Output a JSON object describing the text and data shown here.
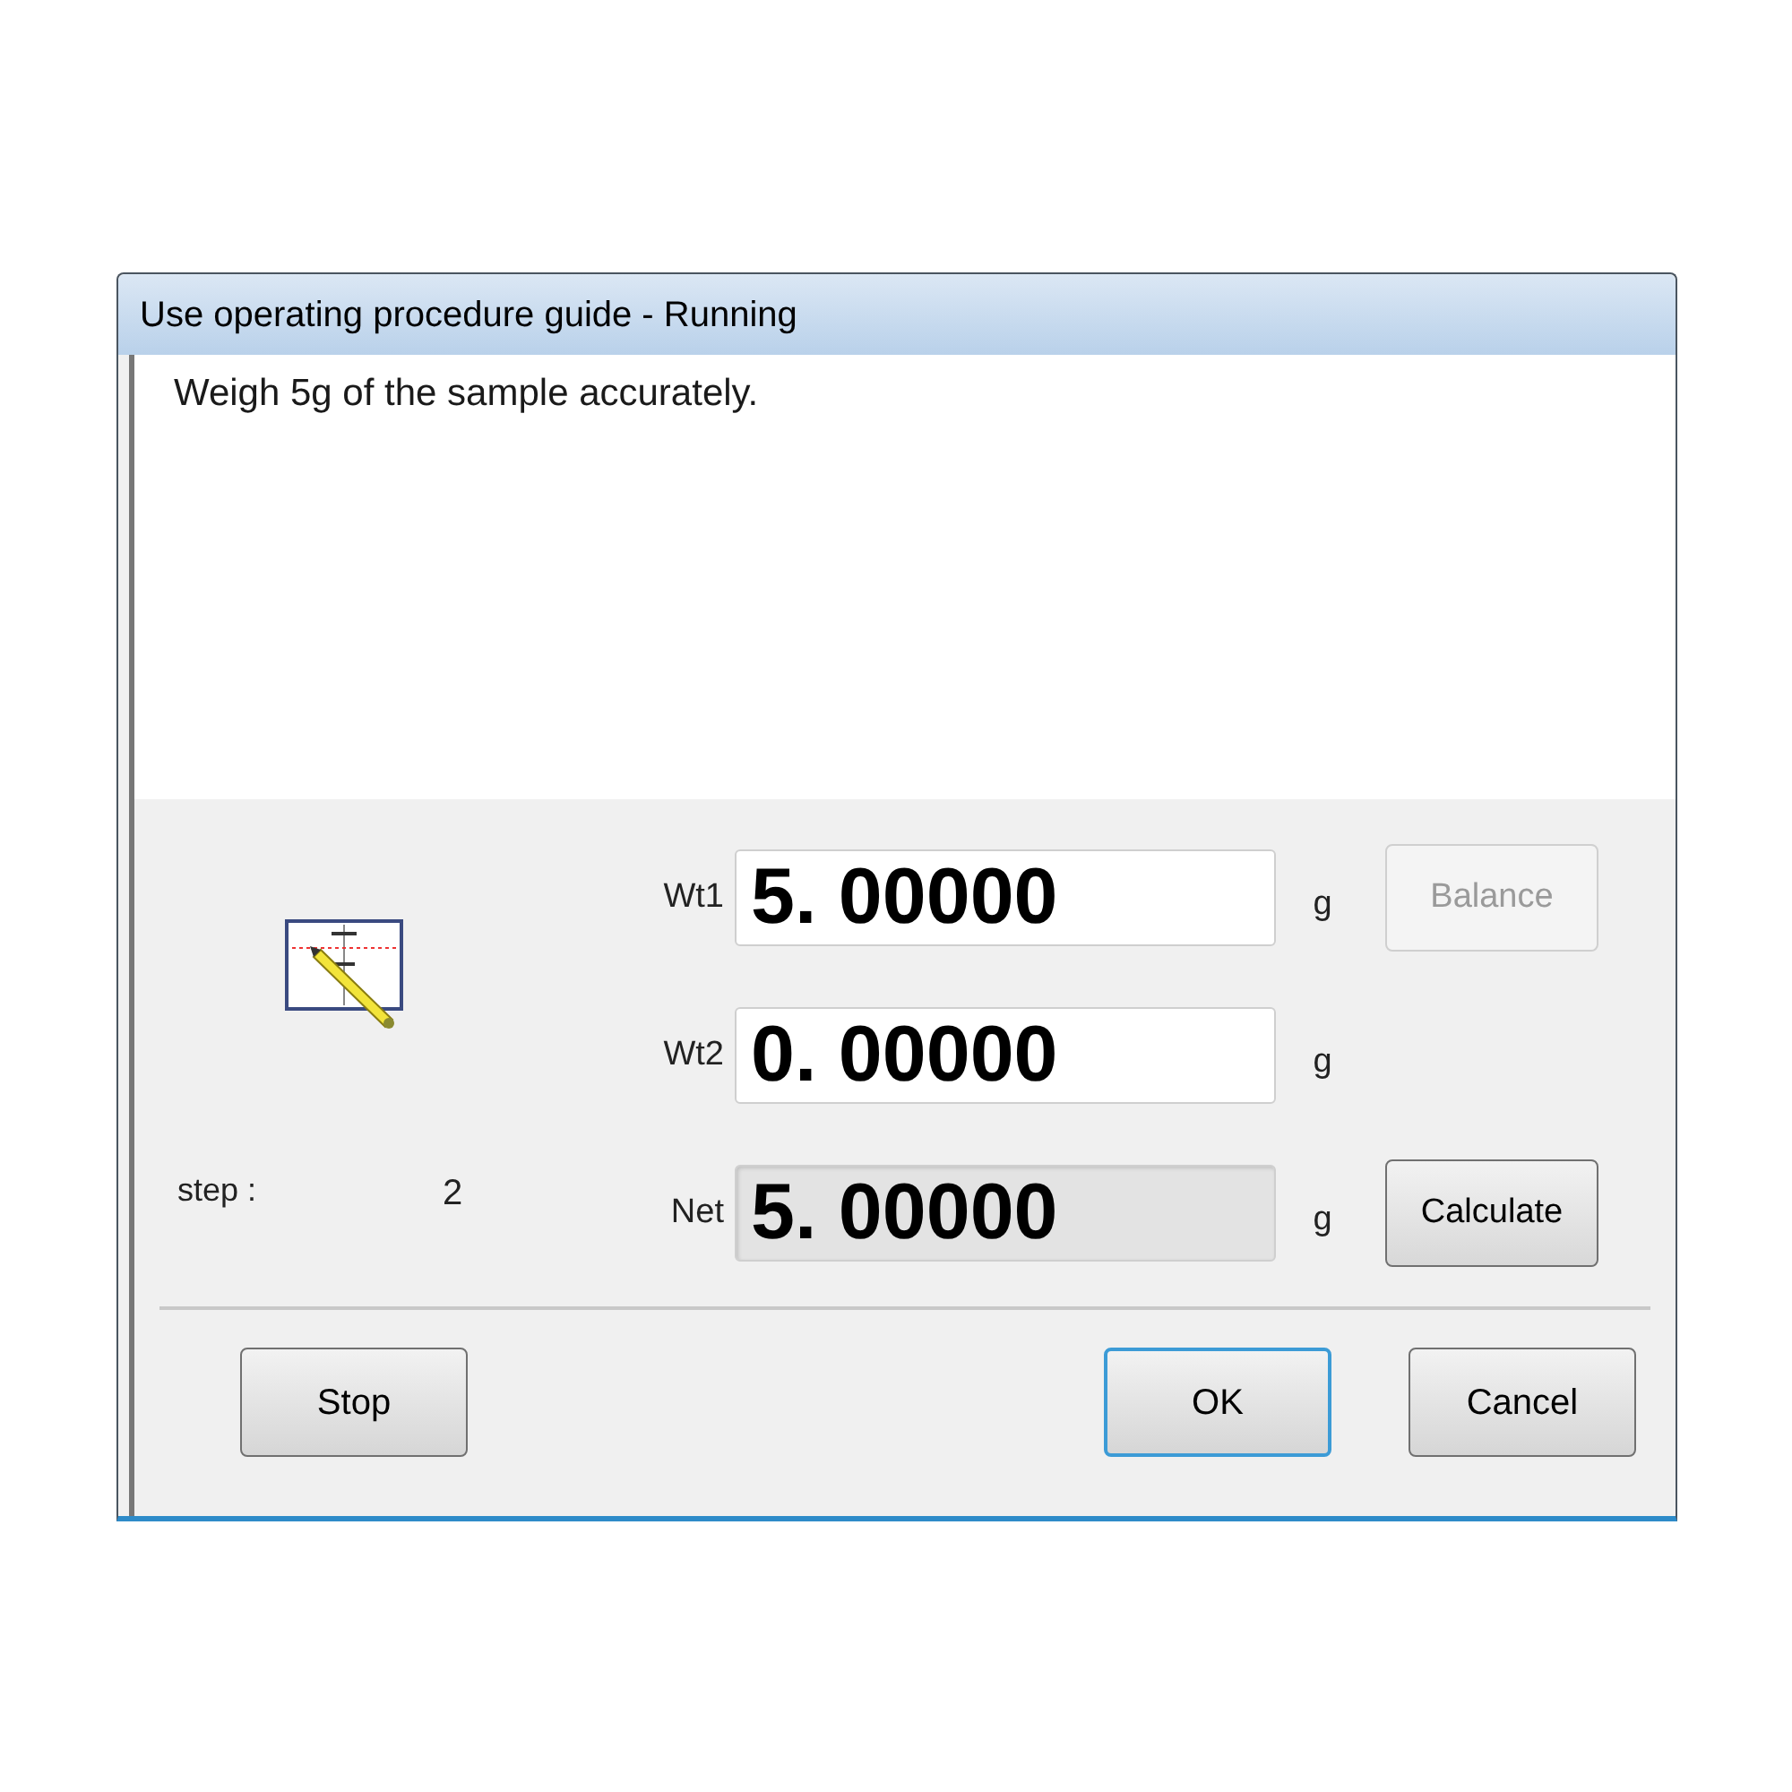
{
  "window": {
    "title": "Use operating procedure guide - Running"
  },
  "instruction": "Weigh 5g of the sample accurately.",
  "step": {
    "label": "step :",
    "value": "2"
  },
  "measurements": [
    {
      "label": "Wt1",
      "value": "5. 00000",
      "unit": "g",
      "readonly": false,
      "button": {
        "label": "Balance",
        "disabled": true
      }
    },
    {
      "label": "Wt2",
      "value": "0. 00000",
      "unit": "g",
      "readonly": false
    },
    {
      "label": "Net",
      "value": "5. 00000",
      "unit": "g",
      "readonly": true,
      "button": {
        "label": "Calculate",
        "disabled": false
      }
    }
  ],
  "buttons": [
    {
      "label": "Stop",
      "default": false
    },
    {
      "label": "OK",
      "default": true
    },
    {
      "label": "Cancel",
      "default": false
    }
  ]
}
